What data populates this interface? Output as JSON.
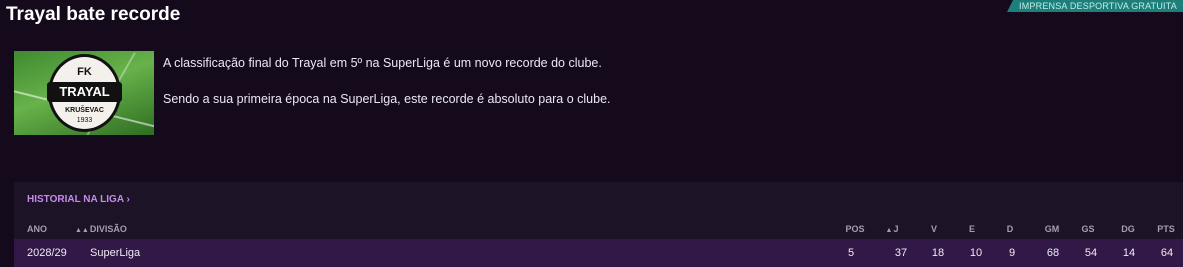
{
  "article": {
    "title": "Trayal bate recorde",
    "source": "IMPRENSA DESPORTIVA GRATUITA",
    "paragraphs": [
      "A classificação final do Trayal em 5º na SuperLiga é um novo recorde do clube.",
      "Sendo a sua primeira época na SuperLiga, este recorde é absoluto para o clube."
    ]
  },
  "crest": {
    "top": "FK",
    "name": "TRAYAL",
    "city": "KRUŠEVAC",
    "year": "1933"
  },
  "league_history": {
    "link_label": "HISTORIAL NA LIGA",
    "link_chevron": "›",
    "headers": {
      "year": "ANO",
      "division": "DIVISÃO",
      "pos": "POS",
      "played": "J",
      "won": "V",
      "drawn": "E",
      "lost": "D",
      "gf": "GM",
      "ga": "GS",
      "gd": "DG",
      "pts": "PTS"
    },
    "rows": [
      {
        "year": "2028/29",
        "division": "SuperLiga",
        "pos": "5",
        "played": "37",
        "won": "18",
        "drawn": "10",
        "lost": "9",
        "gf": "68",
        "ga": "54",
        "gd": "14",
        "pts": "64"
      }
    ]
  }
}
